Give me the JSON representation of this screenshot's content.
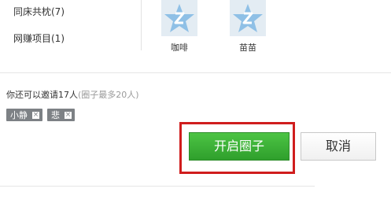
{
  "groups": [
    {
      "label": "同床共枕(7)"
    },
    {
      "label": "网赚项目(1)"
    }
  ],
  "friends": [
    {
      "name": "咖啡",
      "avatar_icon": "qq-star-avatar-icon"
    },
    {
      "name": "苗苗",
      "avatar_icon": "qq-star-avatar-icon"
    }
  ],
  "invite": {
    "text": "你还可以邀请17人",
    "note": "(圈子最多20人)"
  },
  "tags": [
    {
      "label": "小静",
      "close_icon": "close-icon"
    },
    {
      "label": "悲",
      "close_icon": "close-icon"
    }
  ],
  "actions": {
    "open_label": "开启圈子",
    "cancel_label": "取消"
  },
  "colors": {
    "primary_green": "#3fb33b",
    "highlight_red": "#d01d1d",
    "tag_gray": "#7d8185",
    "avatar_blue": "#5aa0d6"
  }
}
